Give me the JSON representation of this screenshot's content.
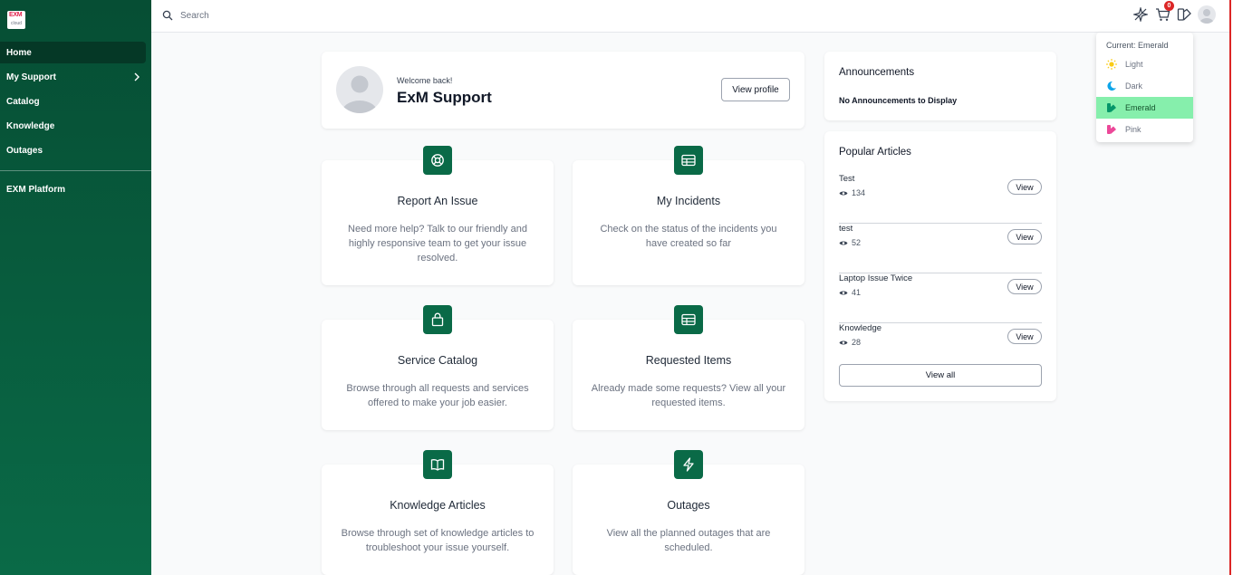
{
  "brand": {
    "logo_text": "EXM",
    "logo_sub": "cloud"
  },
  "sidebar": {
    "items": [
      {
        "label": "Home",
        "active": true
      },
      {
        "label": "My Support",
        "has_submenu": true
      },
      {
        "label": "Catalog"
      },
      {
        "label": "Knowledge"
      },
      {
        "label": "Outages"
      }
    ],
    "secondary": [
      {
        "label": "EXM Platform"
      }
    ]
  },
  "topbar": {
    "search_placeholder": "Search",
    "cart_count": "0",
    "icons": [
      "sparkle-icon",
      "cart-icon",
      "theme-icon",
      "user-avatar"
    ]
  },
  "theme_menu": {
    "current_label": "Current: Emerald",
    "options": [
      {
        "label": "Light",
        "icon": "sun-icon",
        "color": "#facc15"
      },
      {
        "label": "Dark",
        "icon": "moon-icon",
        "color": "#0ea5e9"
      },
      {
        "label": "Emerald",
        "icon": "emerald-icon",
        "color": "#059669",
        "selected": true
      },
      {
        "label": "Pink",
        "icon": "pink-icon",
        "color": "#ec4899"
      }
    ]
  },
  "profile": {
    "welcome": "Welcome back!",
    "name": "ExM Support",
    "button": "View profile"
  },
  "tiles": [
    {
      "title": "Report An Issue",
      "desc": "Need more help? Talk to our friendly and highly responsive team to get your issue resolved.",
      "icon": "lifebuoy-icon"
    },
    {
      "title": "My Incidents",
      "desc": "Check on the status of the incidents you have created so far",
      "icon": "table-icon"
    },
    {
      "title": "Service Catalog",
      "desc": "Browse through all requests and services offered to make your job easier.",
      "icon": "bag-icon"
    },
    {
      "title": "Requested Items",
      "desc": "Already made some requests? View all your requested items.",
      "icon": "table-icon"
    },
    {
      "title": "Knowledge Articles",
      "desc": "Browse through set of knowledge articles to troubleshoot your issue yourself.",
      "icon": "book-icon"
    },
    {
      "title": "Outages",
      "desc": "View all the planned outages that are scheduled.",
      "icon": "bolt-icon"
    }
  ],
  "announcements": {
    "title": "Announcements",
    "empty": "No Announcements to Display"
  },
  "popular": {
    "title": "Popular Articles",
    "articles": [
      {
        "name": "Test",
        "views": "134",
        "button": "View"
      },
      {
        "name": "test",
        "views": "52",
        "button": "View"
      },
      {
        "name": "Laptop Issue Twice",
        "views": "41",
        "button": "View"
      },
      {
        "name": "Knowledge",
        "views": "28",
        "button": "View"
      }
    ],
    "view_all": "View all"
  },
  "colors": {
    "accent": "#0a6a47",
    "sidebar_dark": "#064e34",
    "selected_theme": "#86efac",
    "badge": "#dc2626"
  }
}
